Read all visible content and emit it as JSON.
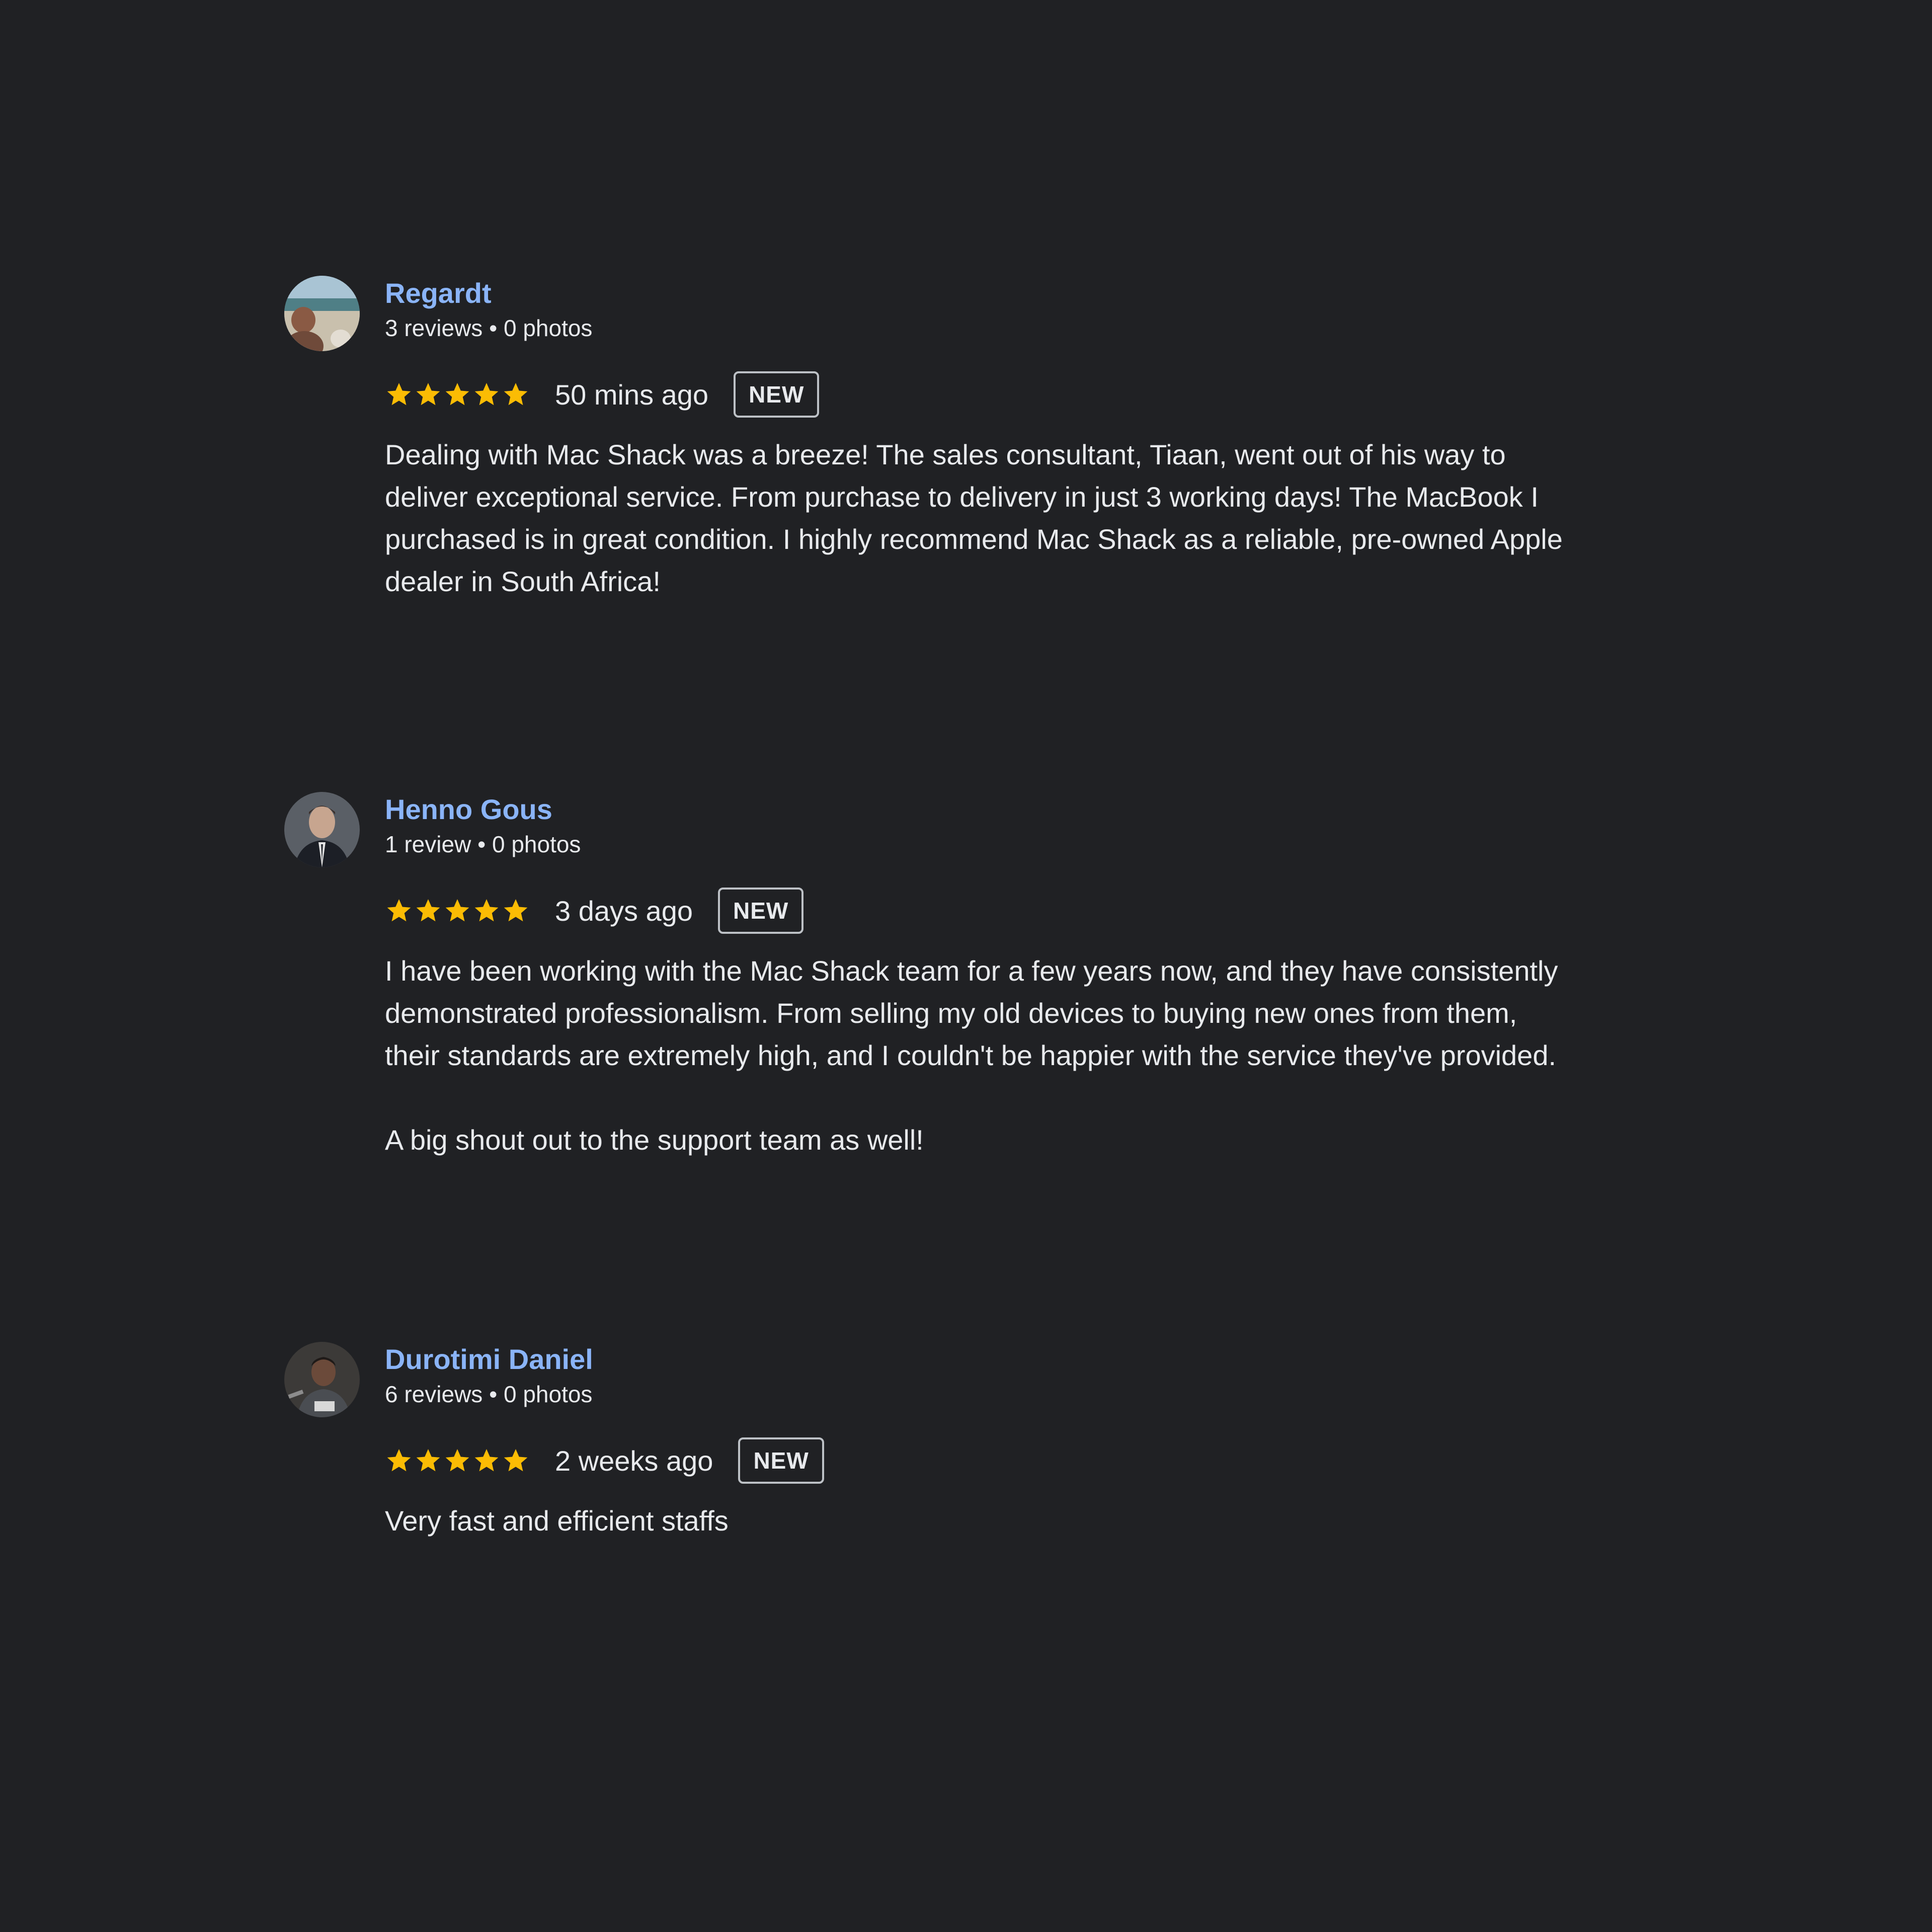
{
  "colors": {
    "background": "#202124",
    "name": "#8ab4f8",
    "text": "#e8eaed",
    "star": "#fbbc04",
    "badge_border": "#bdc1c6"
  },
  "reviews": [
    {
      "name": "Regardt",
      "stats": "3 reviews • 0 photos",
      "rating": 5,
      "time": "50 mins ago",
      "badge": "NEW",
      "text": "Dealing with Mac Shack was a breeze! The sales consultant, Tiaan, went out of his way to\ndeliver exceptional service. From purchase to delivery in just 3 working days! The MacBook I\npurchased is in great condition. I highly recommend Mac Shack as a reliable, pre-owned Apple\ndealer in South Africa!"
    },
    {
      "name": "Henno Gous",
      "stats": "1 review • 0 photos",
      "rating": 5,
      "time": "3 days ago",
      "badge": "NEW",
      "text": "I have been working with the Mac Shack team for a few years now, and they have consistently\ndemonstrated professionalism. From selling my old devices to buying new ones from them,\ntheir standards are extremely high, and I couldn't be happier with the service they've provided.\n\nA big shout out to the support team as well!"
    },
    {
      "name": "Durotimi Daniel",
      "stats": "6 reviews • 0 photos",
      "rating": 5,
      "time": "2 weeks ago",
      "badge": "NEW",
      "text": "Very fast and efficient staffs"
    }
  ]
}
